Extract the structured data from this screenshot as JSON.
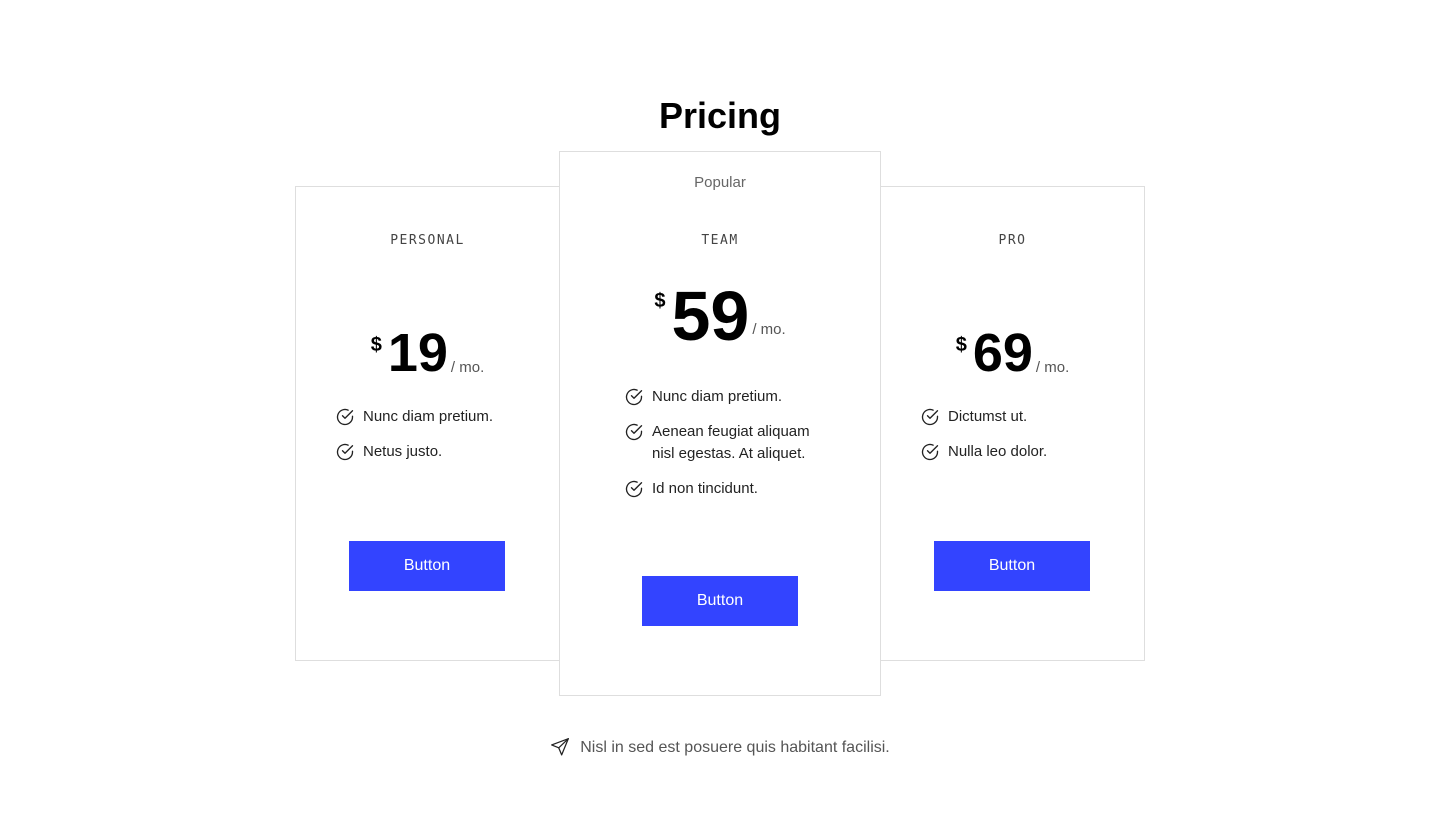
{
  "page": {
    "title": "Pricing",
    "footer_note": "Nisl in sed est posuere quis habitant facilisi."
  },
  "colors": {
    "accent": "#3344ff",
    "border": "#dedede",
    "muted_text": "#666666"
  },
  "plans": [
    {
      "name": "PERSONAL",
      "currency": "$",
      "price": "19",
      "period": "/ mo.",
      "features": [
        "Nunc diam pretium.",
        "Netus justo."
      ],
      "button_label": "Button"
    },
    {
      "badge": "Popular",
      "name": "TEAM",
      "currency": "$",
      "price": "59",
      "period": "/ mo.",
      "features": [
        "Nunc diam pretium.",
        "Aenean feugiat aliquam nisl egestas. At aliquet.",
        "Id non tincidunt."
      ],
      "button_label": "Button"
    },
    {
      "name": "PRO",
      "currency": "$",
      "price": "69",
      "period": "/ mo.",
      "features": [
        "Dictumst ut.",
        "Nulla leo dolor."
      ],
      "button_label": "Button"
    }
  ],
  "icons": {
    "feature": "check-circle-icon",
    "footer": "send-icon"
  }
}
